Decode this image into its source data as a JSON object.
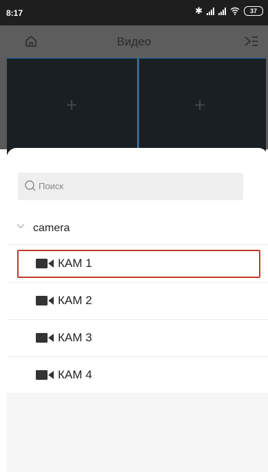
{
  "status_bar": {
    "time": "8:17",
    "bluetooth_icon": "bluetooth-icon",
    "battery": "37"
  },
  "nav": {
    "title": "Видео",
    "home_icon": "home-icon",
    "menu_icon": "menu-icon"
  },
  "video_grid": {
    "cells": 2,
    "plus_icon": "plus-icon"
  },
  "search": {
    "placeholder": "Поиск",
    "value": ""
  },
  "device_tree": {
    "group": {
      "label": "camera",
      "expanded": true
    },
    "cameras": [
      {
        "label": "КАМ 1",
        "selected": true
      },
      {
        "label": "КАМ 2",
        "selected": false
      },
      {
        "label": "КАМ 3",
        "selected": false
      },
      {
        "label": "КАМ 4",
        "selected": false
      }
    ]
  },
  "colors": {
    "highlight": "#c0392b",
    "divider": "#2c6fb8",
    "nav_bg": "#5d5d5d",
    "sheet_bg": "#ffffff"
  }
}
